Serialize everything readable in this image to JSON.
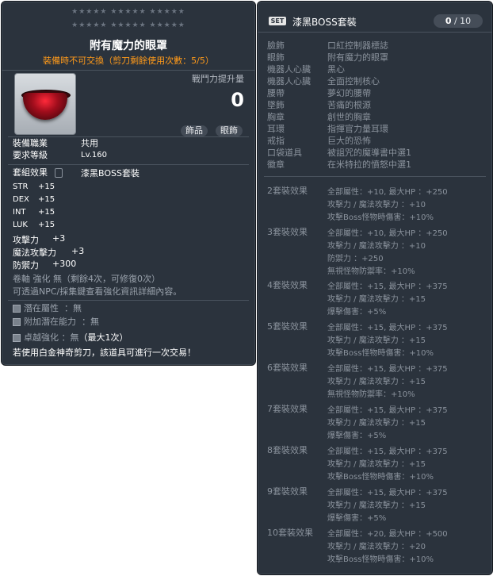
{
  "item": {
    "stars_row1": "★★★★★  ★★★★★  ★★★★★",
    "stars_row2": "★★★★★  ★★★★★  ★★★★★",
    "name": "附有魔力的眼罩",
    "trade_note": "裝備時不可交換（剪刀剩餘使用次數：5/5）",
    "icon": "dark-red-bowl-eye-patch",
    "power_label": "戰鬥力提升量",
    "power_value": "0",
    "tag_type": "飾品",
    "tag_slot": "眼飾",
    "job_label": "裝備職業",
    "job_value": "共用",
    "level_label": "要求等級",
    "level_value": "Lv.160",
    "set_label": "套組效果",
    "set_value": "漆黑BOSS套裝",
    "stats": [
      {
        "name": "STR",
        "value": "+15"
      },
      {
        "name": "DEX",
        "value": "+15"
      },
      {
        "name": "INT",
        "value": "+15"
      },
      {
        "name": "LUK",
        "value": "+15"
      },
      {
        "name": "攻擊力",
        "value": "+3"
      },
      {
        "name": "魔法攻擊力",
        "value": "+3"
      },
      {
        "name": "防禦力",
        "value": "+300"
      }
    ],
    "scroll_line": "卷軸 強化 無（剩餘4次，可修復0次）",
    "npc_line": "可透過NPC/採集鍵查看強化資訊詳細內容。",
    "potential_label": "潛在屬性",
    "potential_value": "：無",
    "bonus_potential_label": "附加潛在能力",
    "bonus_potential_value": "：無",
    "exceptional_label": "卓越強化",
    "exceptional_value": "：無",
    "exceptional_max": "（最大1次）",
    "platinum_note": "若使用白金神奇剪刀，該道具可進行一次交易！"
  },
  "set": {
    "badge": "SET",
    "name": "漆黑BOSS套裝",
    "count_have": "0",
    "count_sep": " / ",
    "count_total": "10",
    "parts": [
      {
        "slot": "臉飾",
        "name": "口紅控制器標誌"
      },
      {
        "slot": "眼飾",
        "name": "附有魔力的眼罩"
      },
      {
        "slot": "機器人心臟",
        "name": "黑心"
      },
      {
        "slot": "機器人心臟",
        "name": "全面控制核心"
      },
      {
        "slot": "腰帶",
        "name": "夢幻的腰帶"
      },
      {
        "slot": "墜飾",
        "name": "苦痛的根源"
      },
      {
        "slot": "胸章",
        "name": "創世的胸章"
      },
      {
        "slot": "耳環",
        "name": "指揮官力量耳環"
      },
      {
        "slot": "戒指",
        "name": "巨大的恐怖"
      },
      {
        "slot": "口袋道具",
        "name": "被詛咒的魔導書中選1"
      },
      {
        "slot": "徽章",
        "name": "在米特拉的憤怒中選1"
      }
    ],
    "effects": [
      {
        "title": "2套裝效果",
        "lines": [
          "全部屬性：+10, 最大HP  ：+250",
          "攻擊力 / 魔法攻擊力  ：+10",
          "攻擊Boss怪物時傷害：+10%"
        ]
      },
      {
        "title": "3套裝效果",
        "lines": [
          "全部屬性：+10, 最大HP  ：+250",
          "攻擊力 / 魔法攻擊力  ：+10",
          "防禦力  ：+250",
          "無視怪物防禦率：+10%"
        ]
      },
      {
        "title": "4套裝效果",
        "lines": [
          "全部屬性：+15, 最大HP  ：+375",
          "攻擊力 / 魔法攻擊力  ：+15",
          "爆擊傷害：+5%"
        ]
      },
      {
        "title": "5套裝效果",
        "lines": [
          "全部屬性：+15, 最大HP  ：+375",
          "攻擊力 / 魔法攻擊力  ：+15",
          "攻擊Boss怪物時傷害：+10%"
        ]
      },
      {
        "title": "6套裝效果",
        "lines": [
          "全部屬性：+15, 最大HP  ：+375",
          "攻擊力 / 魔法攻擊力  ：+15",
          "無視怪物防禦率：+10%"
        ]
      },
      {
        "title": "7套裝效果",
        "lines": [
          "全部屬性：+15, 最大HP  ：+375",
          "攻擊力 / 魔法攻擊力  ：+15",
          "爆擊傷害：+5%"
        ]
      },
      {
        "title": "8套裝效果",
        "lines": [
          "全部屬性：+15, 最大HP  ：+375",
          "攻擊力 / 魔法攻擊力  ：+15",
          "攻擊Boss怪物時傷害：+10%"
        ]
      },
      {
        "title": "9套裝效果",
        "lines": [
          "全部屬性：+15, 最大HP  ：+375",
          "攻擊力 / 魔法攻擊力  ：+15",
          "爆擊傷害：+5%"
        ]
      },
      {
        "title": "10套裝效果",
        "lines": [
          "全部屬性：+20, 最大HP  ：+500",
          "攻擊力 / 魔法攻擊力  ：+20",
          "攻擊Boss怪物時傷害：+10%"
        ]
      }
    ]
  },
  "colors": {
    "panel_bg": "#2b333d",
    "trade_orange": "#ff9a1a",
    "muted_gray": "#8a929c"
  }
}
